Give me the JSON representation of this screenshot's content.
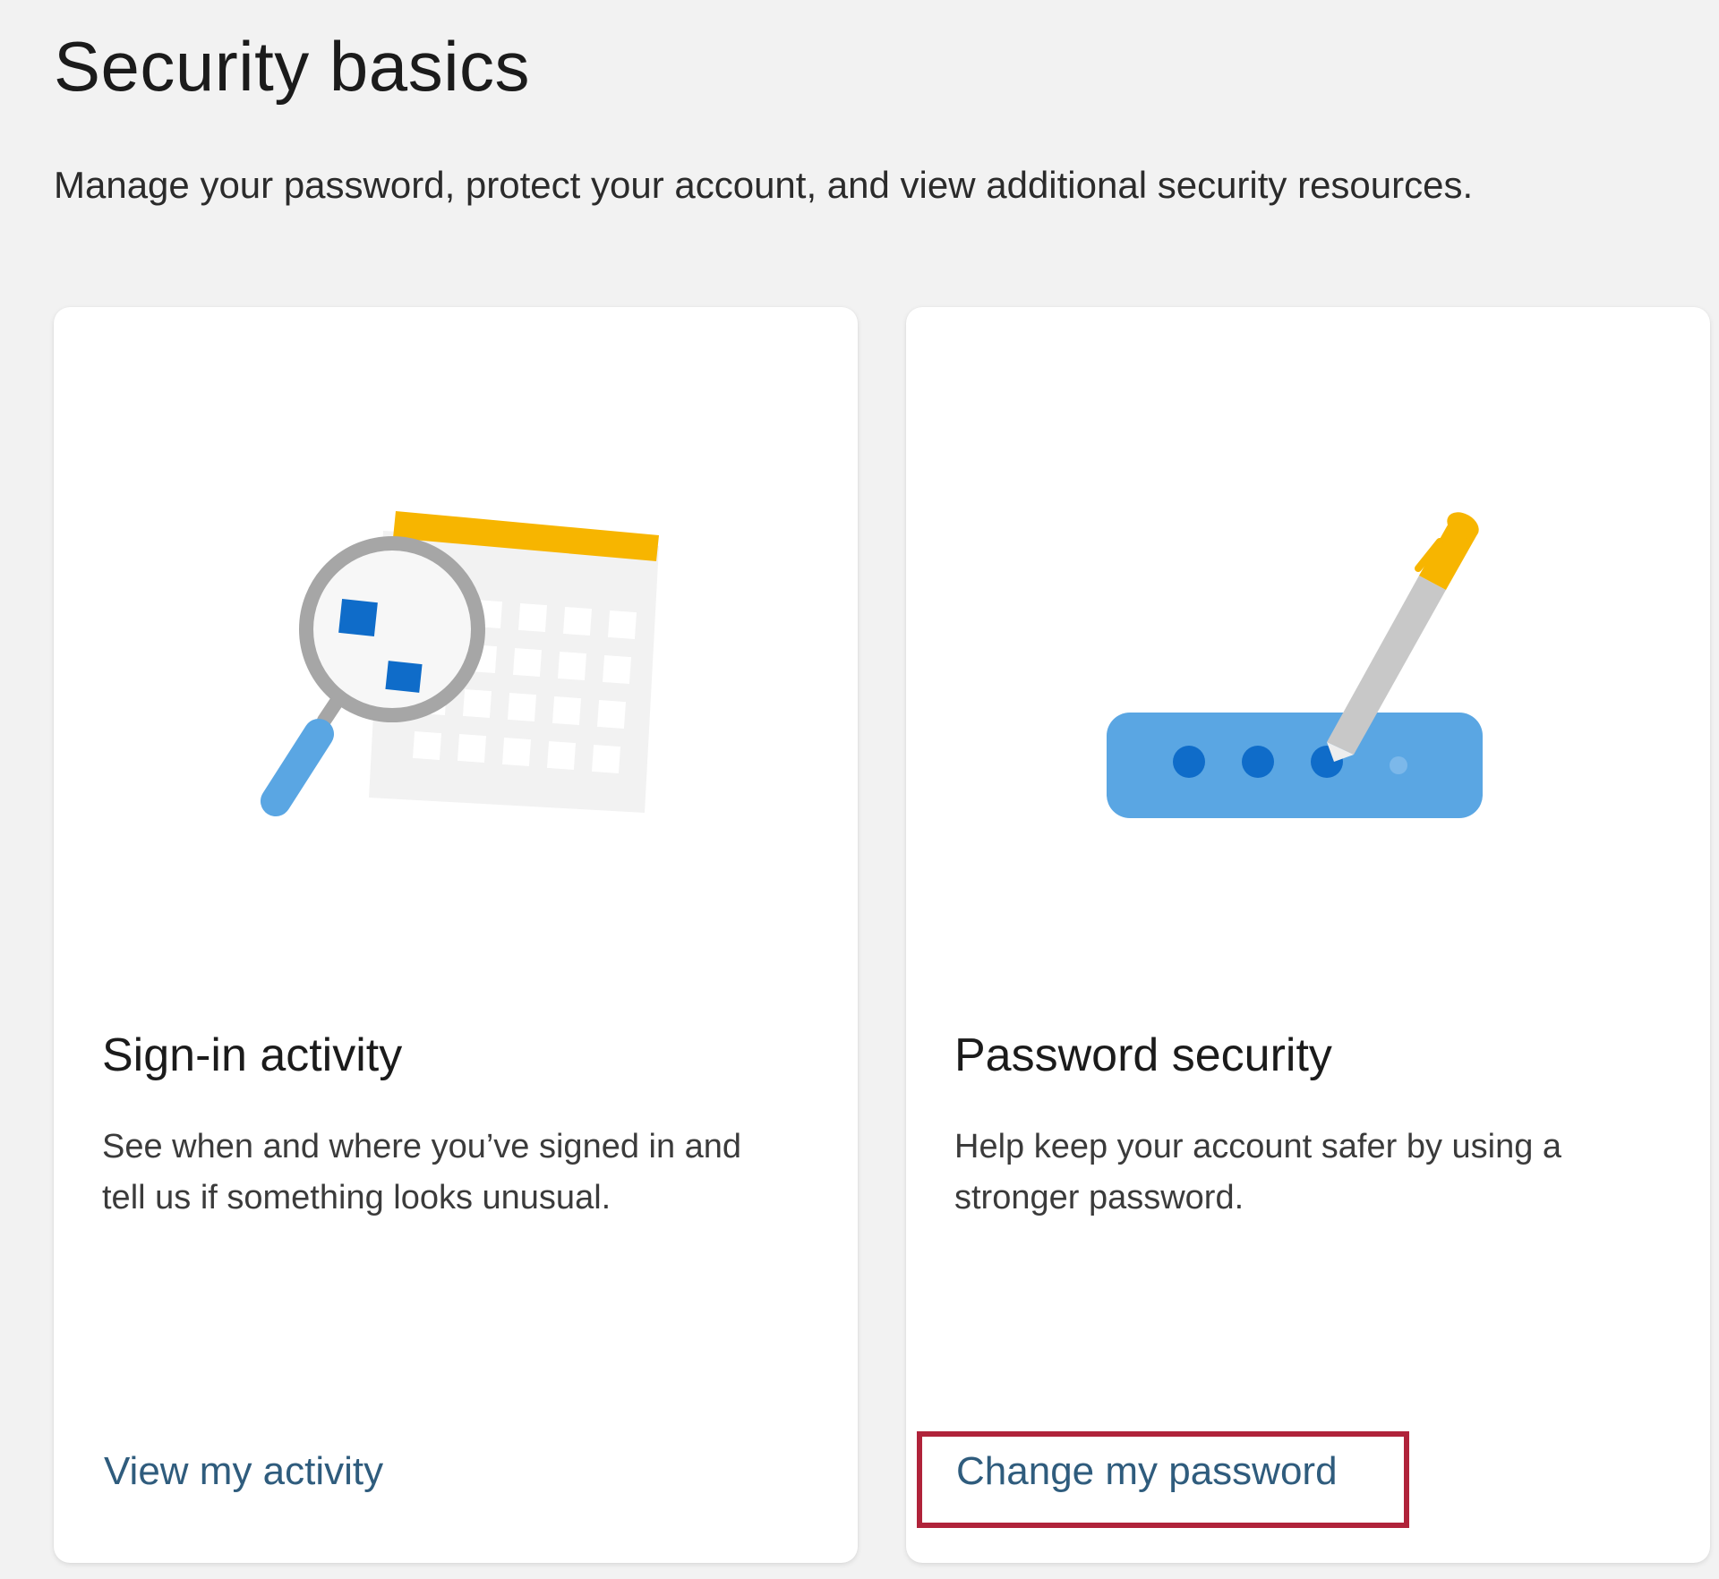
{
  "page": {
    "title": "Security basics",
    "subtitle": "Manage your password, protect your account, and view additional security resources."
  },
  "cards": [
    {
      "title": "Sign-in activity",
      "description": "See when and where you’ve signed in and tell us if something looks unusual.",
      "link": "View my activity",
      "illustration": "magnifier-calendar-icon"
    },
    {
      "title": "Password security",
      "description": "Help keep your account safer by using a stronger password.",
      "link": "Change my password",
      "illustration": "password-pen-icon",
      "highlighted": true
    }
  ],
  "colors": {
    "background": "#f2f2f2",
    "card": "#ffffff",
    "link": "#2f5c7d",
    "highlight_border": "#b0233a",
    "accent_blue": "#0f6cc9",
    "light_blue": "#5aa6e3",
    "yellow": "#f7b500",
    "gray": "#a6a6a6"
  }
}
